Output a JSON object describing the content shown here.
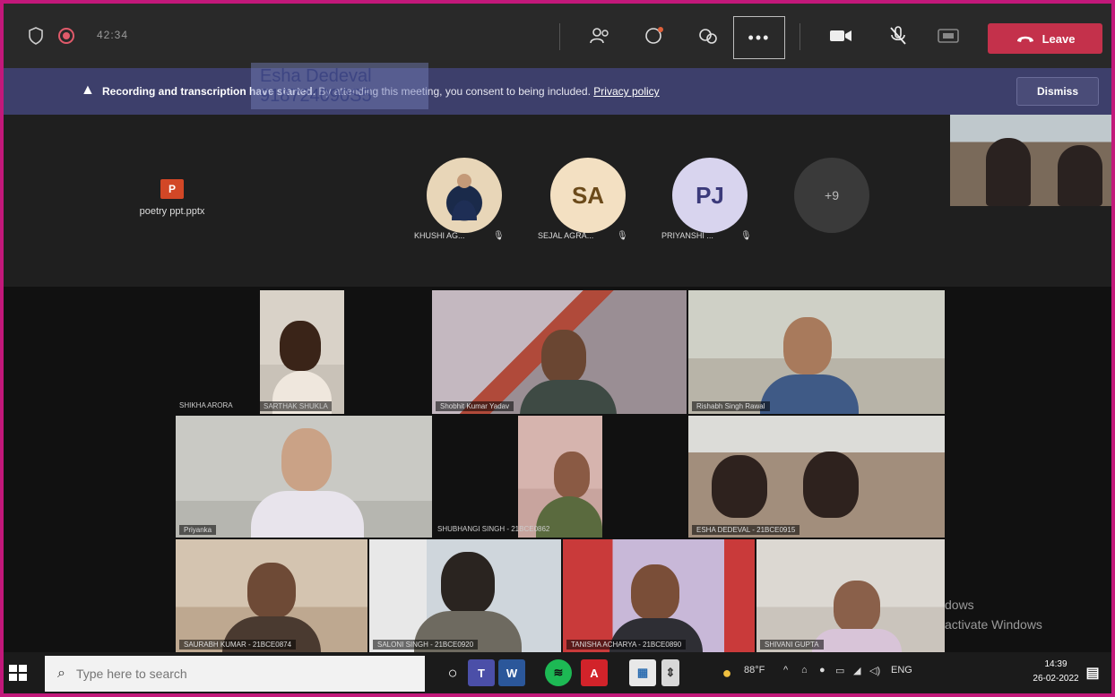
{
  "meeting": {
    "timer": "42:34",
    "more_label": "•••",
    "leave_label": "Leave"
  },
  "banner": {
    "bold_text": "Recording and transcription have started.",
    "text": "By attending this meeting, you consent to being included.",
    "link": "Privacy policy",
    "dismiss": "Dismiss",
    "overlay_line1": "Esha Dedeval",
    "overlay_line2": "918724090S5"
  },
  "shared": {
    "file_name": "poetry ppt.pptx",
    "file_icon_letter": "P",
    "participants": [
      {
        "initials": "",
        "name": "KHUSHI AG..."
      },
      {
        "initials": "SA",
        "name": "SEJAL AGRA..."
      },
      {
        "initials": "PJ",
        "name": "PRIYANSHI ..."
      },
      {
        "initials": "+9",
        "name": ""
      }
    ]
  },
  "tiles": [
    {
      "label": "SARTHAK SHUKLA"
    },
    {
      "label": "Shobhit Kumar Yadav"
    },
    {
      "label": "Rishabh Singh Rawal"
    },
    {
      "label": "Priyanka"
    },
    {
      "label": "SHUBHANGI SINGH - 21BCE0862"
    },
    {
      "label": "ESHA DEDEVAL - 21BCE0915"
    },
    {
      "label": "SAURABH KUMAR - 21BCE0874"
    },
    {
      "label": "SALONI SINGH - 21BCE0920"
    },
    {
      "label": "TANISHA ACHARYA - 21BCE0890"
    },
    {
      "label": "SHIVANI GUPTA"
    }
  ],
  "outside_label": "SHIKHA ARORA",
  "windows_watermark": {
    "line1": "dows",
    "line2": "activate Windows"
  },
  "taskbar": {
    "search_placeholder": "Type here to search",
    "weather": "88°F",
    "lang": "ENG",
    "time": "14:39",
    "date": "26-02-2022"
  }
}
